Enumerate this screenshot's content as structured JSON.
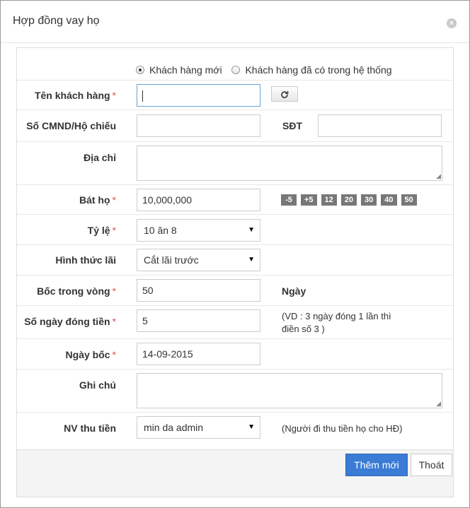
{
  "modal": {
    "title": "Hợp đồng vay họ",
    "close_icon": "×"
  },
  "customer_type": {
    "options": [
      "Khách hàng mới",
      "Khách hàng đã có trong hệ thống"
    ],
    "selected": "Khách hàng mới"
  },
  "fields": {
    "customer_name": {
      "label": "Tên khách hàng",
      "required": true,
      "value": ""
    },
    "id_number": {
      "label": "Số CMND/Hộ chiếu",
      "value": ""
    },
    "phone": {
      "label": "SĐT",
      "value": ""
    },
    "address": {
      "label": "Địa chỉ",
      "value": ""
    },
    "bat_ho": {
      "label": "Bát họ",
      "required": true,
      "value": "10,000,000"
    },
    "ratio": {
      "label": "Tỷ lệ",
      "required": true,
      "value": "10 ăn 8"
    },
    "interest_type": {
      "label": "Hình thức lãi",
      "value": "Cắt lãi trước"
    },
    "boc_trong_vong": {
      "label": "Bốc trong vòng",
      "required": true,
      "value": "50",
      "unit": "Ngày"
    },
    "payment_days": {
      "label": "Số ngày đóng tiền",
      "required": true,
      "value": "5",
      "note_line1": "(VD : 3 ngày đóng 1 lần thì",
      "note_line2": "điền số 3 )"
    },
    "start_date": {
      "label": "Ngày bốc",
      "required": true,
      "value": "14-09-2015"
    },
    "note": {
      "label": "Ghi chú",
      "value": ""
    },
    "collector": {
      "label": "NV thu tiền",
      "value": "min da admin",
      "hint": "(Người đi thu tiền họ cho HĐ)"
    }
  },
  "quick_buttons": [
    "-5",
    "+5",
    "12",
    "20",
    "30",
    "40",
    "50"
  ],
  "icons": {
    "refresh": "refresh-icon",
    "select_arrow": "▼"
  },
  "actions": {
    "submit": "Thêm mới",
    "cancel": "Thoát"
  },
  "colors": {
    "primary": "#3a7bd5",
    "required": "#d9534f",
    "quick_button": "#777777"
  }
}
